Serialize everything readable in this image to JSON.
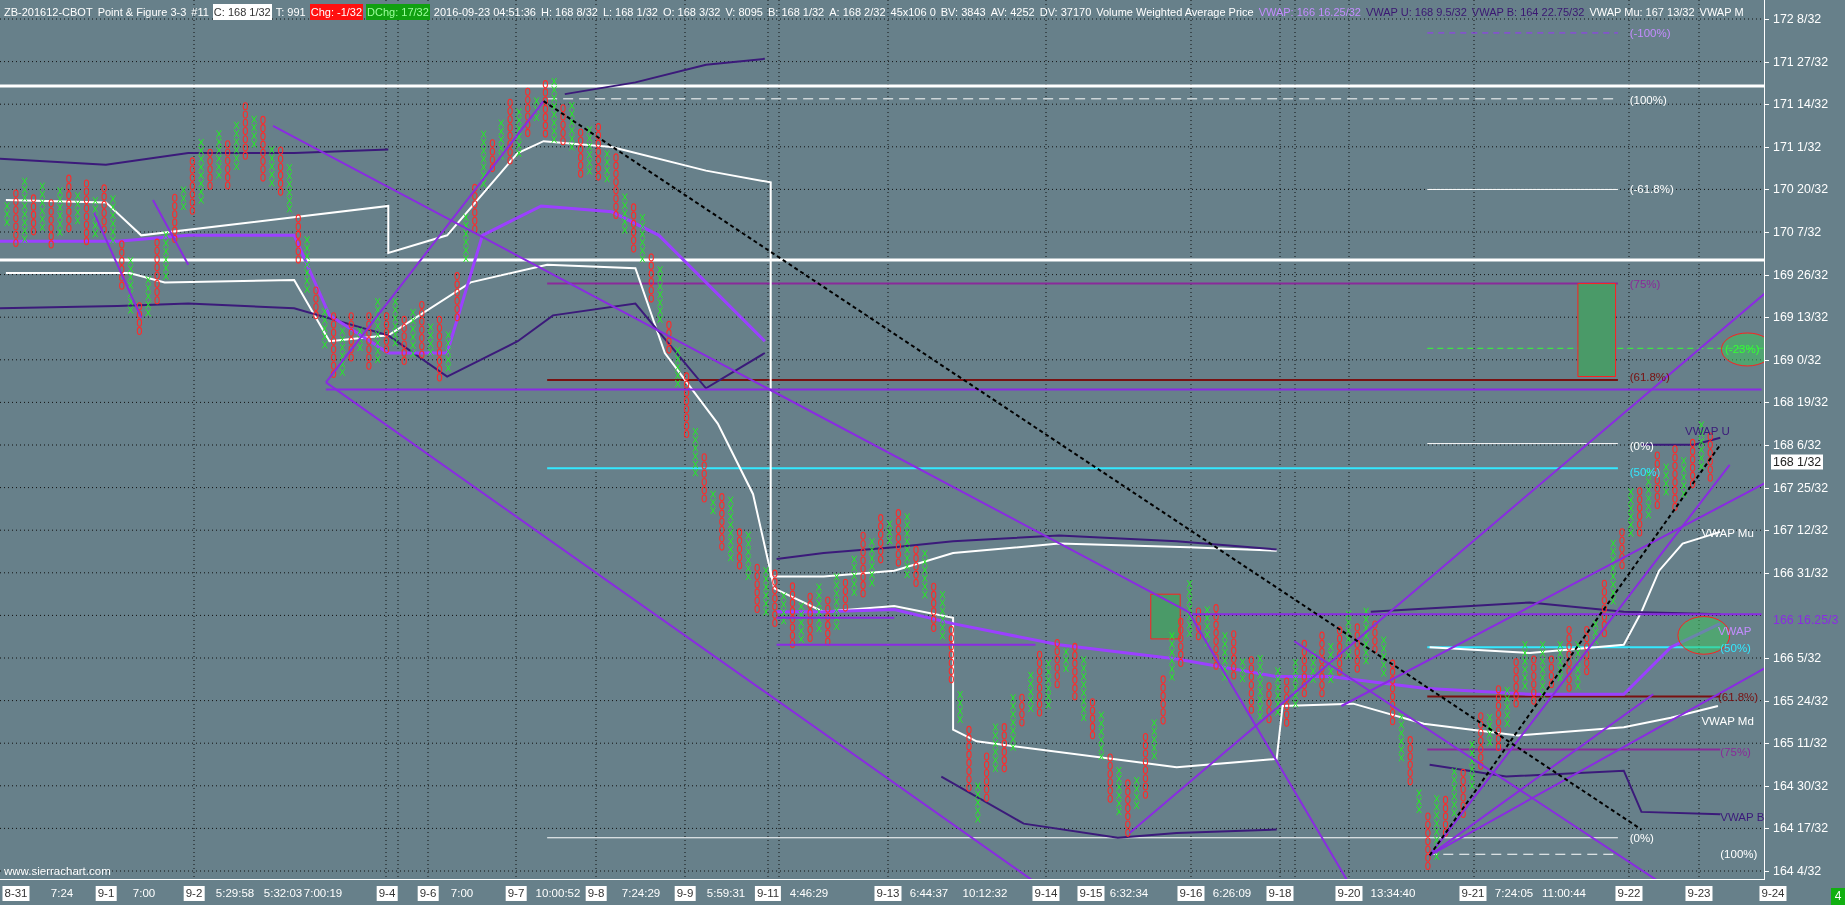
{
  "header": [
    {
      "text": "ZB-201612-CBOT",
      "kind": "plain"
    },
    {
      "text": "Point & Figure 3-3",
      "kind": "plain"
    },
    {
      "text": "#11",
      "kind": "plain"
    },
    {
      "text": "C: 168 1/32",
      "kind": "highlight"
    },
    {
      "text": "T: 991",
      "kind": "plain"
    },
    {
      "text": "Chg: -1/32",
      "kind": "down"
    },
    {
      "text": "DChg: 17/32",
      "kind": "up"
    },
    {
      "text": "2016-09-23 04:51:36",
      "kind": "plain"
    },
    {
      "text": "H: 168 8/32",
      "kind": "plain"
    },
    {
      "text": "L: 168 1/32",
      "kind": "plain"
    },
    {
      "text": "O: 168 3/32",
      "kind": "plain"
    },
    {
      "text": "V: 8095",
      "kind": "plain"
    },
    {
      "text": "B: 168 1/32",
      "kind": "plain"
    },
    {
      "text": "A: 168 2/32",
      "kind": "plain"
    },
    {
      "text": "45x106 0",
      "kind": "plain"
    },
    {
      "text": "BV: 3843",
      "kind": "plain"
    },
    {
      "text": "AV: 4252",
      "kind": "plain"
    },
    {
      "text": "DV: 37170",
      "kind": "plain"
    },
    {
      "text": "Volume Weighted Average Price",
      "kind": "plain"
    },
    {
      "text": "VWAP: 166 16.25/32",
      "kind": "vwap"
    },
    {
      "text": "VWAP U: 168 9.5/32",
      "kind": "vwap-dark"
    },
    {
      "text": "VWAP B: 164 22.75/32",
      "kind": "vwap-dark"
    },
    {
      "text": "VWAP Mu: 167 13/32",
      "kind": "plain"
    },
    {
      "text": "VWAP M",
      "kind": "plain"
    }
  ],
  "annotations": [
    {
      "text": "(-100%)",
      "color": "#c48cff"
    },
    {
      "text": "(100%)",
      "color": "#ffffff"
    },
    {
      "text": "(-61.8%)",
      "color": "#ffffff"
    },
    {
      "text": "(75%)",
      "color": "#8a2a9a"
    },
    {
      "text": "(-23%)",
      "color": "#33ff33"
    },
    {
      "text": "(61.8%)",
      "color": "#7a1010"
    },
    {
      "text": "VWAP U",
      "color": "#3b1a7a"
    },
    {
      "text": "(0%)",
      "color": "#ffffff"
    },
    {
      "text": "(50%)",
      "color": "#33e8ff"
    },
    {
      "text": "VWAP Mu",
      "color": "#ffffff"
    },
    {
      "text": "VWAP",
      "color": "#c48cff"
    },
    {
      "text": "(50%)",
      "color": "#33e8ff"
    },
    {
      "text": "(61.8%)",
      "color": "#7a1010"
    },
    {
      "text": "VWAP Md",
      "color": "#ffffff"
    },
    {
      "text": "(75%)",
      "color": "#8a2a9a"
    },
    {
      "text": "VWAP B",
      "color": "#3b1a7a"
    },
    {
      "text": "(0%)",
      "color": "#ffffff"
    },
    {
      "text": "(100%)",
      "color": "#ffffff"
    }
  ],
  "watermark_text": "www.sierrachart.com",
  "price_axis": [
    {
      "text": "172 8/32",
      "kind": "tick"
    },
    {
      "text": "171 27/32",
      "kind": "tick"
    },
    {
      "text": "171 14/32",
      "kind": "tick"
    },
    {
      "text": "171 1/32",
      "kind": "tick"
    },
    {
      "text": "170 20/32",
      "kind": "tick"
    },
    {
      "text": "170 7/32",
      "kind": "tick"
    },
    {
      "text": "169 26/32",
      "kind": "tick"
    },
    {
      "text": "169 13/32",
      "kind": "tick"
    },
    {
      "text": "169 0/32",
      "kind": "tick"
    },
    {
      "text": "168 19/32",
      "kind": "tick"
    },
    {
      "text": "168 6/32",
      "kind": "tick"
    },
    {
      "text": "168 1/32",
      "kind": "current"
    },
    {
      "text": "167 25/32",
      "kind": "tick"
    },
    {
      "text": "167 12/32",
      "kind": "tick"
    },
    {
      "text": "166 31/32",
      "kind": "tick"
    },
    {
      "text": "166 16.25/3",
      "kind": "vwap"
    },
    {
      "text": "166 5/32",
      "kind": "tick"
    },
    {
      "text": "165 24/32",
      "kind": "tick"
    },
    {
      "text": "165 11/32",
      "kind": "tick"
    },
    {
      "text": "164 30/32",
      "kind": "tick"
    },
    {
      "text": "164 17/32",
      "kind": "tick"
    },
    {
      "text": "164 4/32",
      "kind": "tick"
    }
  ],
  "time_axis": [
    {
      "text": "8-31",
      "kind": "date"
    },
    {
      "text": "7:24",
      "kind": "time"
    },
    {
      "text": "9-1",
      "kind": "date"
    },
    {
      "text": "7:00",
      "kind": "time"
    },
    {
      "text": "9-2",
      "kind": "date"
    },
    {
      "text": "5:29:58",
      "kind": "time"
    },
    {
      "text": "5:32:03",
      "kind": "time"
    },
    {
      "text": "7:00:19",
      "kind": "time"
    },
    {
      "text": "9-4",
      "kind": "date"
    },
    {
      "text": "9-6",
      "kind": "date"
    },
    {
      "text": "7:00",
      "kind": "time"
    },
    {
      "text": "9-7",
      "kind": "date"
    },
    {
      "text": "10:00:52",
      "kind": "time"
    },
    {
      "text": "9-8",
      "kind": "date"
    },
    {
      "text": "7:24:29",
      "kind": "time"
    },
    {
      "text": "9-9",
      "kind": "date"
    },
    {
      "text": "5:59:31",
      "kind": "time"
    },
    {
      "text": "9-11",
      "kind": "date"
    },
    {
      "text": "4:46:29",
      "kind": "time"
    },
    {
      "text": "9-13",
      "kind": "date"
    },
    {
      "text": "6:44:37",
      "kind": "time"
    },
    {
      "text": "10:12:32",
      "kind": "time"
    },
    {
      "text": "9-14",
      "kind": "date"
    },
    {
      "text": "9-15",
      "kind": "date"
    },
    {
      "text": "6:32:34",
      "kind": "time"
    },
    {
      "text": "9-16",
      "kind": "date"
    },
    {
      "text": "6:26:09",
      "kind": "time"
    },
    {
      "text": "9-18",
      "kind": "date"
    },
    {
      "text": "9-20",
      "kind": "date"
    },
    {
      "text": "13:34:40",
      "kind": "time"
    },
    {
      "text": "9-21",
      "kind": "date"
    },
    {
      "text": "7:24:05",
      "kind": "time"
    },
    {
      "text": "11:00:44",
      "kind": "time"
    },
    {
      "text": "9-22",
      "kind": "date"
    },
    {
      "text": "9-23",
      "kind": "date"
    },
    {
      "text": "9-24",
      "kind": "date"
    }
  ],
  "corner_badge": "4"
}
